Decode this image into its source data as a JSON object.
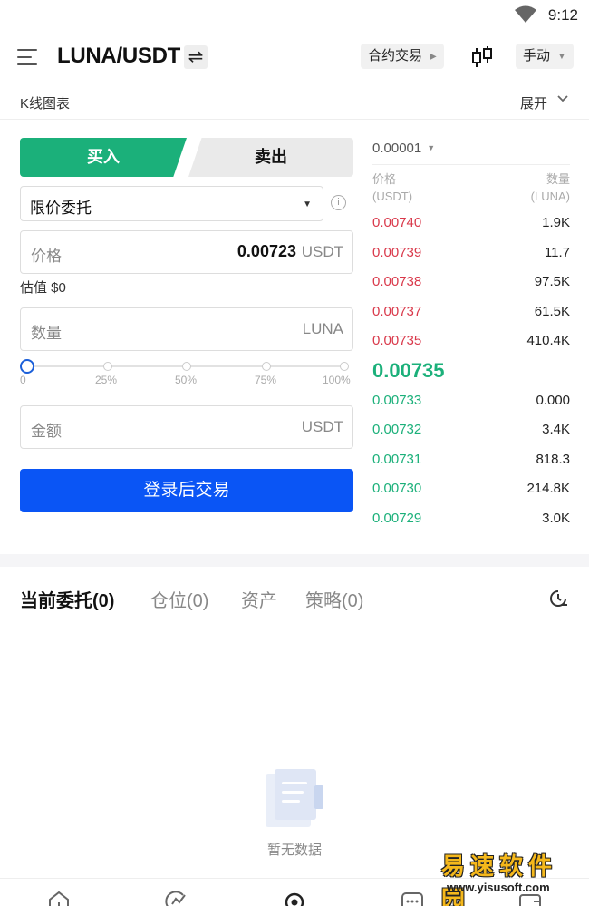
{
  "status_bar": {
    "time": "9:12"
  },
  "header": {
    "pair": "LUNA/USDT",
    "swap_glyph": "⇌",
    "contract_label": "合约交易",
    "mode_label": "手动"
  },
  "kline": {
    "label": "K线图表",
    "expand_label": "展开"
  },
  "trade": {
    "buy_label": "买入",
    "sell_label": "卖出",
    "order_type": "限价委托",
    "price_placeholder": "价格",
    "price_value": "0.00723",
    "price_unit": "USDT",
    "estimate": "估值 $0",
    "amount_placeholder": "数量",
    "amount_unit": "LUNA",
    "slider_labels": [
      "0",
      "25%",
      "50%",
      "75%",
      "100%"
    ],
    "slider_value_percent": 0,
    "total_placeholder": "金额",
    "total_unit": "USDT",
    "login_button": "登录后交易"
  },
  "order_book": {
    "precision": "0.00001",
    "price_header": "价格",
    "price_header_unit": "(USDT)",
    "qty_header": "数量",
    "qty_header_unit": "(LUNA)",
    "asks": [
      {
        "price": "0.00740",
        "qty": "1.9K"
      },
      {
        "price": "0.00739",
        "qty": "11.7"
      },
      {
        "price": "0.00738",
        "qty": "97.5K"
      },
      {
        "price": "0.00737",
        "qty": "61.5K"
      },
      {
        "price": "0.00735",
        "qty": "410.4K"
      }
    ],
    "last_price": "0.00735",
    "bids": [
      {
        "price": "0.00733",
        "qty": "0.000"
      },
      {
        "price": "0.00732",
        "qty": "3.4K"
      },
      {
        "price": "0.00731",
        "qty": "818.3"
      },
      {
        "price": "0.00730",
        "qty": "214.8K"
      },
      {
        "price": "0.00729",
        "qty": "3.0K"
      }
    ]
  },
  "orders": {
    "tabs": [
      "当前委托(0)",
      "仓位(0)",
      "资产",
      "策略(0)"
    ],
    "empty_text": "暂无数据"
  },
  "watermark": {
    "title": "易速软件园",
    "url": "www.yisusoft.com"
  },
  "colors": {
    "buy": "#1bb07a",
    "sell": "#d9384a",
    "primary": "#0a55f5"
  }
}
